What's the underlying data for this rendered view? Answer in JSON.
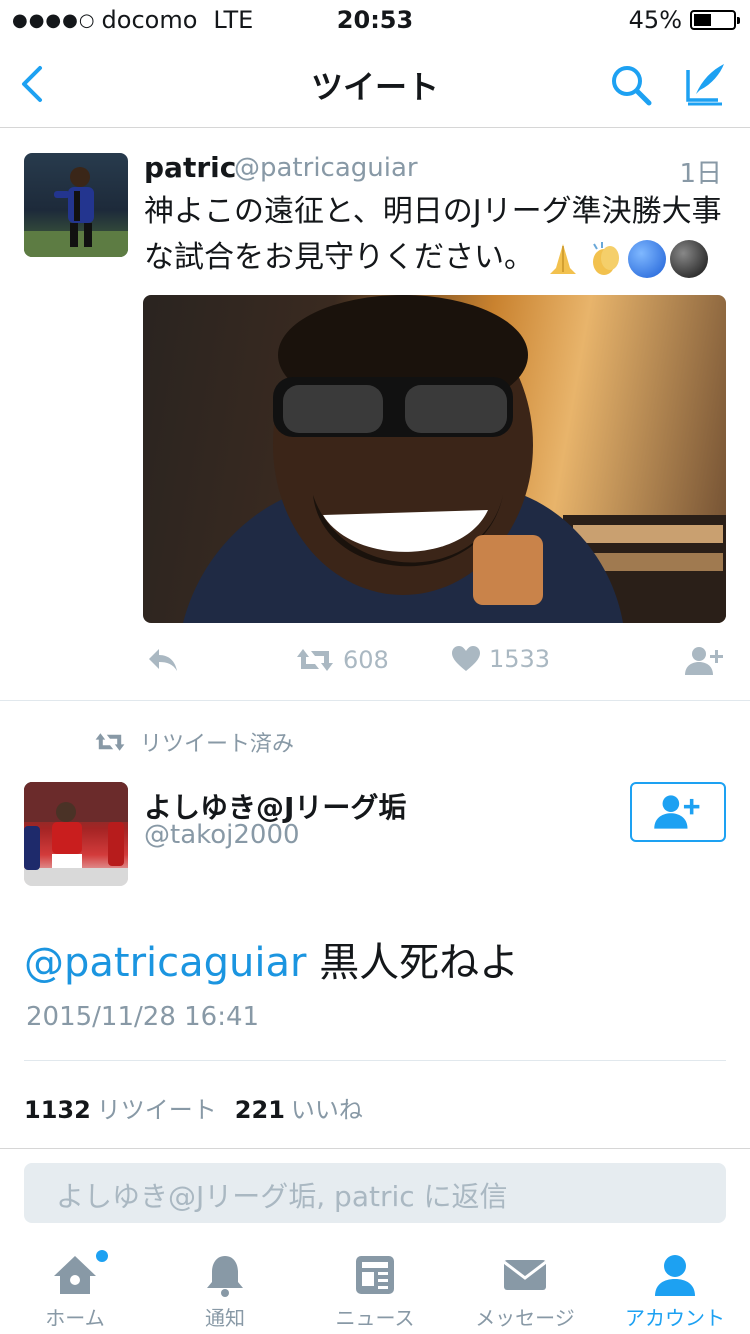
{
  "status_bar": {
    "signal": "●●●●○",
    "carrier": "docomo",
    "network": "LTE",
    "time": "20:53",
    "battery": "45%",
    "battery_fraction": 0.45
  },
  "nav": {
    "title": "ツイート"
  },
  "tweet1": {
    "name": "patric",
    "handle": "@patricaguiar",
    "time": "1日",
    "text": "神よこの遠征と、明日のJリーグ準決勝大事な試合をお見守りください。",
    "retweets": "608",
    "likes": "1533"
  },
  "retweet_label": "リツイート済み",
  "tweet2": {
    "name": "よしゆき@Jリーグ垢",
    "handle": "@takoj2000",
    "mention": "@patricaguiar",
    "text": "黒人死ねよ",
    "date": "2015/11/28 16:41",
    "retweet_count": "1132",
    "retweet_label": "リツイート",
    "like_count": "221",
    "like_label": "いいね"
  },
  "reply": {
    "placeholder": "よしゆき@Jリーグ垢, patric に返信"
  },
  "tabbar": {
    "items": [
      {
        "label": "ホーム",
        "icon": "home-icon"
      },
      {
        "label": "通知",
        "icon": "bell-icon"
      },
      {
        "label": "ニュース",
        "icon": "news-icon"
      },
      {
        "label": "メッセージ",
        "icon": "envelope-icon"
      },
      {
        "label": "アカウント",
        "icon": "person-icon"
      }
    ]
  },
  "colors": {
    "accent": "#1da1f2",
    "mention": "#1b95e0",
    "muted": "#8899a6"
  }
}
